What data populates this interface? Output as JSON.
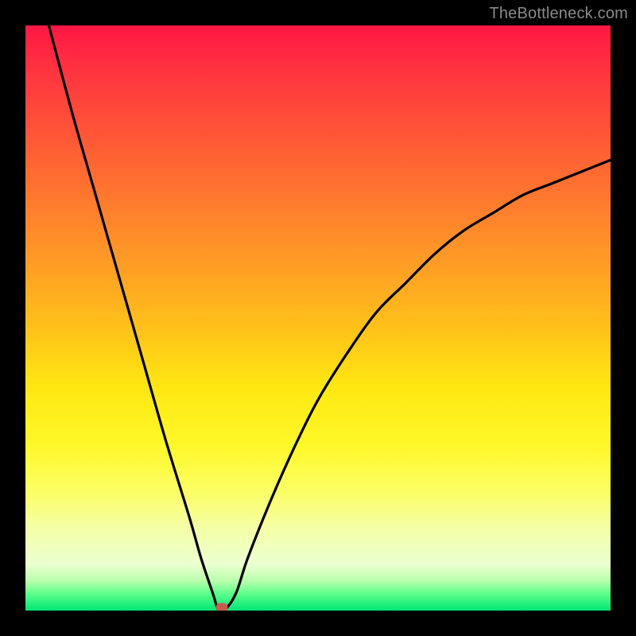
{
  "attribution": "TheBottleneck.com",
  "colors": {
    "page_bg": "#000000",
    "curve": "#000000",
    "marker": "#c85a52",
    "gradient_top": "#ff1744",
    "gradient_mid": "#ffe812",
    "gradient_bottom": "#00e676"
  },
  "chart_data": {
    "type": "line",
    "title": "",
    "xlabel": "",
    "ylabel": "",
    "xlim": [
      0,
      100
    ],
    "ylim": [
      0,
      100
    ],
    "grid": false,
    "legend_position": "none",
    "series": [
      {
        "name": "bottleneck-curve",
        "x": [
          4,
          8,
          12,
          16,
          20,
          24,
          28,
          30,
          32,
          33,
          34,
          36,
          38,
          42,
          46,
          50,
          55,
          60,
          65,
          70,
          75,
          80,
          85,
          90,
          95,
          100
        ],
        "y": [
          100,
          85,
          71,
          57,
          43,
          29,
          16,
          9,
          3,
          0,
          0,
          3,
          9,
          19,
          28,
          36,
          44,
          51,
          56,
          61,
          65,
          68,
          71,
          73,
          75,
          77
        ]
      }
    ],
    "annotations": [
      {
        "name": "optimum-marker",
        "x": 33.5,
        "y": 0.5
      }
    ]
  }
}
